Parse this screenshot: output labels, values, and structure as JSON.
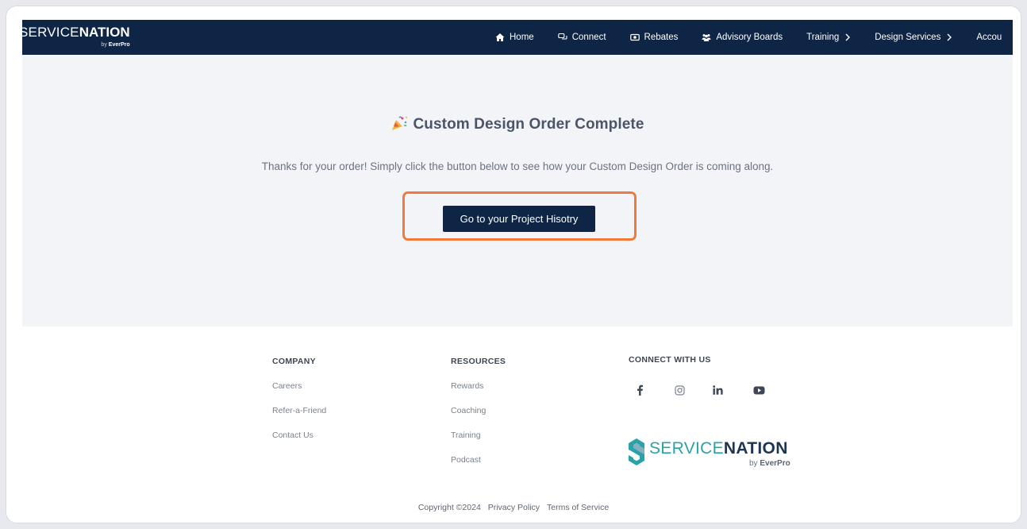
{
  "logo": {
    "word1": "SERVICE",
    "word2": "NATION",
    "by": "by",
    "by_brand": "EverPro"
  },
  "nav": {
    "items": [
      {
        "label": "Home",
        "icon": "home-icon"
      },
      {
        "label": "Connect",
        "icon": "chat-icon"
      },
      {
        "label": "Rebates",
        "icon": "money-icon"
      },
      {
        "label": "Advisory Boards",
        "icon": "people-icon"
      },
      {
        "label": "Training",
        "icon": "chevron-right-icon"
      },
      {
        "label": "Design Services",
        "icon": "chevron-right-icon"
      },
      {
        "label": "Accou"
      }
    ]
  },
  "hero": {
    "title": "Custom Design Order Complete",
    "title_icon": "party-popper-icon",
    "message": "Thanks for your order! Simply click the button below to see how your Custom Design Order is coming along.",
    "button_label": "Go to your Project Hisotry",
    "highlight_color": "#ef7a3c"
  },
  "footer": {
    "company": {
      "heading": "COMPANY",
      "links": [
        "Careers",
        "Refer-a-Friend",
        "Contact Us"
      ]
    },
    "resources": {
      "heading": "RESOURCES",
      "links": [
        "Rewards",
        "Coaching",
        "Training",
        "Podcast"
      ]
    },
    "connect": {
      "heading": "CONNECT WITH US",
      "socials": [
        "facebook-icon",
        "instagram-icon",
        "linkedin-icon",
        "youtube-icon"
      ]
    },
    "brand": {
      "word1": "SERVICE",
      "word2": "NATION",
      "by": "by",
      "by_brand": "EverPro"
    },
    "copyright": "Copyright ©2024",
    "privacy": "Privacy Policy",
    "terms": "Terms of Service"
  },
  "colors": {
    "navy": "#0f2545",
    "hero_bg": "#f3f4f8",
    "accent": "#ef7a3c",
    "teal": "#2aa3a8"
  }
}
